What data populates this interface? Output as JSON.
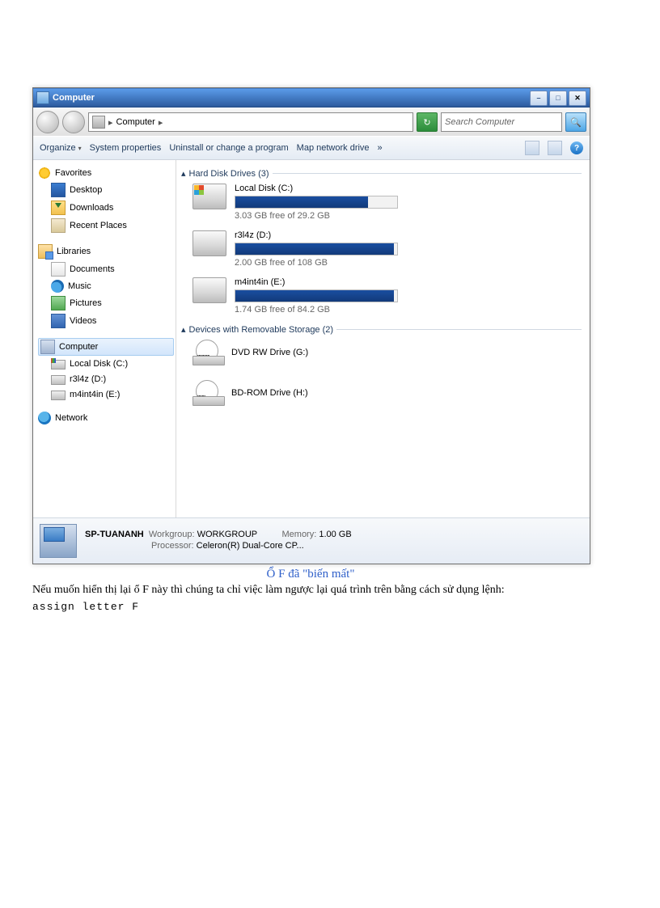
{
  "window": {
    "title": "Computer"
  },
  "address": {
    "label": "Computer"
  },
  "search": {
    "placeholder": "Search Computer"
  },
  "toolbar": {
    "organize": "Organize",
    "sysprops": "System properties",
    "uninstall": "Uninstall or change a program",
    "mapdrive": "Map network drive",
    "more": "»"
  },
  "sidebar": {
    "favorites": "Favorites",
    "desktop": "Desktop",
    "downloads": "Downloads",
    "recent": "Recent Places",
    "libraries": "Libraries",
    "documents": "Documents",
    "music": "Music",
    "pictures": "Pictures",
    "videos": "Videos",
    "computer": "Computer",
    "localc": "Local Disk (C:)",
    "drv_d": "r3l4z (D:)",
    "drv_e": "m4int4in (E:)",
    "network": "Network"
  },
  "groups": {
    "hdd": "Hard Disk Drives (3)",
    "removable": "Devices with Removable Storage (2)"
  },
  "drives": [
    {
      "name": "Local Disk (C:)",
      "free": "3.03 GB free of 29.2 GB",
      "fill": 82
    },
    {
      "name": "r3l4z (D:)",
      "free": "2.00 GB free of 108 GB",
      "fill": 98
    },
    {
      "name": "m4int4in (E:)",
      "free": "1.74 GB free of 84.2 GB",
      "fill": 98
    }
  ],
  "devices": [
    {
      "name": "DVD RW Drive (G:)",
      "label": "DVD"
    },
    {
      "name": "BD-ROM Drive (H:)",
      "label": "BD"
    }
  ],
  "details": {
    "name": "SP-TUANANH",
    "workgroup_lbl": "Workgroup:",
    "workgroup": "WORKGROUP",
    "memory_lbl": "Memory:",
    "memory": "1.00 GB",
    "processor_lbl": "Processor:",
    "processor": "Celeron(R) Dual-Core CP..."
  },
  "caption": "Ổ F đã \"biến mất\"",
  "para1": "Nếu muốn hiển thị lại ổ F này thì chúng ta chỉ việc làm ngược lại quá trình trên bằng cách sử dụng lệnh:",
  "code": "assign letter F"
}
